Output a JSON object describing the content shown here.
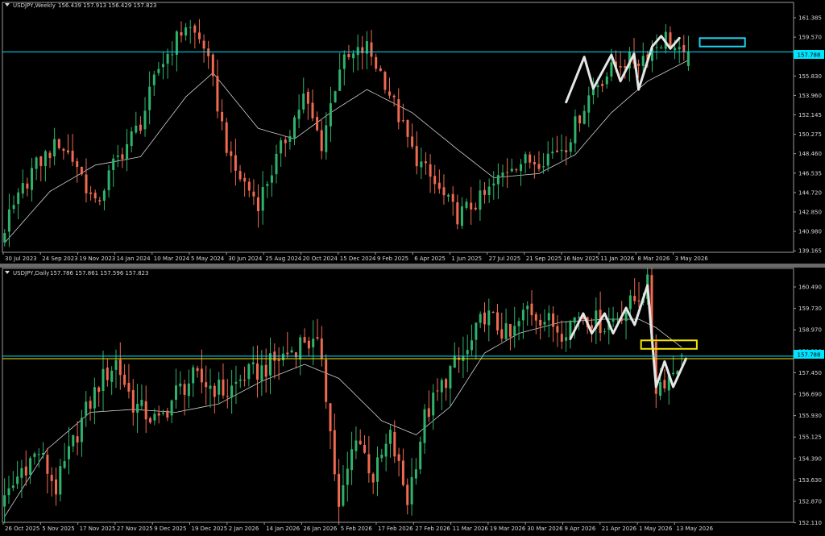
{
  "theme": {
    "background": "#000000",
    "frame": "#9a9a9a",
    "text": "#d8d8d8",
    "bull": "#2fb36c",
    "bear": "#ee6a50",
    "ma": "#d0d0d0",
    "zigzag": "#e6e6e6",
    "price_label_bg": "#00e5ff",
    "cyan_line": "#00e5ff",
    "yellow_line": "#f2e600",
    "cyan_box": "#1fd0f0",
    "yellow_box": "#f2e600"
  },
  "panes": [
    {
      "id": "weekly",
      "header": {
        "menu_icon": "triangle-down-icon",
        "symbol": "USDJPY,Weekly",
        "ohlc": "156.439 157.913 156.429 157.823"
      },
      "current_price_label": "157.788",
      "y_ticks": [
        "161.385",
        "159.570",
        "157.755",
        "155.830",
        "153.960",
        "152.145",
        "150.275",
        "148.460",
        "146.535",
        "144.720",
        "142.850",
        "140.980",
        "139.165"
      ],
      "x_labels": [
        "30 Jul 2023",
        "24 Sep 2023",
        "19 Nov 2023",
        "14 Jan 2024",
        "10 Mar 2024",
        "5 May 2024",
        "30 Jun 2024",
        "25 Aug 2024",
        "20 Oct 2024",
        "15 Dec 2024",
        "9 Feb 2025",
        "6 Apr 2025",
        "1 Jun 2025",
        "27 Jul 2025",
        "21 Sep 2025",
        "16 Nov 2025",
        "11 Jan 2026",
        "8 Mar 2026",
        "3 May 2026"
      ]
    },
    {
      "id": "daily",
      "header": {
        "menu_icon": "triangle-down-icon",
        "symbol": "USDJPY,Daily",
        "ohlc": "157.786 157.861 157.596 157.823"
      },
      "current_price_label": "157.788",
      "y_ticks": [
        "160.490",
        "159.730",
        "158.970",
        "158.210",
        "157.450",
        "156.690",
        "155.930",
        "155.125",
        "154.390",
        "153.630",
        "152.870",
        "152.110"
      ],
      "x_labels": [
        "26 Oct 2025",
        "5 Nov 2025",
        "17 Nov 2025",
        "27 Nov 2025",
        "9 Dec 2025",
        "19 Dec 2025",
        "2 Jan 2026",
        "14 Jan 2026",
        "26 Jan 2026",
        "5 Feb 2026",
        "17 Feb 2026",
        "27 Feb 2026",
        "11 Mar 2026",
        "19 Mar 2026",
        "30 Mar 2026",
        "9 Apr 2026",
        "21 Apr 2026",
        "1 May 2026",
        "13 May 2026"
      ]
    }
  ],
  "chart_data": [
    {
      "type": "candlestick",
      "symbol": "USDJPY",
      "timeframe": "Weekly",
      "last_ohlc": {
        "open": 156.439,
        "high": 157.913,
        "low": 156.429,
        "close": 157.823
      },
      "current_price": 157.788,
      "ylim": [
        138.7,
        162.5
      ],
      "x_range": [
        "30 Jul 2023",
        "May 2026"
      ],
      "close_anchors": [
        [
          0,
          141.0
        ],
        [
          6,
          146.5
        ],
        [
          12,
          149.2
        ],
        [
          16,
          147.0
        ],
        [
          20,
          143.0
        ],
        [
          24,
          147.0
        ],
        [
          30,
          151.0
        ],
        [
          34,
          156.2
        ],
        [
          40,
          160.4
        ],
        [
          44,
          158.5
        ],
        [
          50,
          147.0
        ],
        [
          56,
          143.5
        ],
        [
          62,
          149.5
        ],
        [
          66,
          153.5
        ],
        [
          70,
          149.0
        ],
        [
          74,
          156.5
        ],
        [
          80,
          158.2
        ],
        [
          84,
          155.0
        ],
        [
          90,
          148.3
        ],
        [
          96,
          144.5
        ],
        [
          100,
          142.2
        ],
        [
          106,
          144.0
        ],
        [
          112,
          147.2
        ],
        [
          118,
          147.5
        ],
        [
          124,
          149.0
        ],
        [
          130,
          154.5
        ],
        [
          136,
          156.8
        ],
        [
          140,
          157.0
        ],
        [
          146,
          159.2
        ],
        [
          150,
          157.0
        ],
        [
          151,
          157.8
        ]
      ],
      "moving_average_anchors": [
        [
          0,
          139.6
        ],
        [
          10,
          144.5
        ],
        [
          20,
          147.0
        ],
        [
          30,
          147.8
        ],
        [
          40,
          153.5
        ],
        [
          46,
          155.8
        ],
        [
          56,
          150.5
        ],
        [
          64,
          149.5
        ],
        [
          72,
          152.0
        ],
        [
          80,
          154.2
        ],
        [
          90,
          152.0
        ],
        [
          100,
          148.5
        ],
        [
          108,
          145.8
        ],
        [
          118,
          146.2
        ],
        [
          126,
          148.0
        ],
        [
          134,
          152.0
        ],
        [
          142,
          155.0
        ],
        [
          151,
          157.0
        ]
      ],
      "zigzag": [
        [
          124,
          153.0
        ],
        [
          128,
          157.3
        ],
        [
          130,
          154.3
        ],
        [
          134,
          157.5
        ],
        [
          136,
          155.0
        ],
        [
          139,
          157.6
        ],
        [
          140,
          154.2
        ],
        [
          143,
          158.3
        ],
        [
          145,
          159.3
        ],
        [
          147,
          158.1
        ],
        [
          149,
          159.1
        ]
      ],
      "horizontal_level": 157.788,
      "target_box": {
        "x_from": 153.5,
        "x_to": 163.5,
        "y_from": 158.3,
        "y_to": 159.1
      }
    },
    {
      "type": "candlestick",
      "symbol": "USDJPY",
      "timeframe": "Daily",
      "last_ohlc": {
        "open": 157.786,
        "high": 157.861,
        "low": 157.596,
        "close": 157.823
      },
      "current_price": 157.788,
      "ylim": [
        151.9,
        160.9
      ],
      "x_range": [
        "26 Oct 2025",
        "May 2026"
      ],
      "close_anchors": [
        [
          0,
          152.6
        ],
        [
          4,
          153.8
        ],
        [
          8,
          154.4
        ],
        [
          12,
          153.1
        ],
        [
          18,
          155.5
        ],
        [
          22,
          156.8
        ],
        [
          26,
          157.6
        ],
        [
          30,
          156.1
        ],
        [
          36,
          155.4
        ],
        [
          40,
          156.5
        ],
        [
          44,
          157.0
        ],
        [
          52,
          156.5
        ],
        [
          56,
          157.1
        ],
        [
          60,
          157.3
        ],
        [
          66,
          157.9
        ],
        [
          70,
          158.4
        ],
        [
          74,
          157.9
        ],
        [
          78,
          152.3
        ],
        [
          82,
          155.1
        ],
        [
          86,
          153.5
        ],
        [
          90,
          154.9
        ],
        [
          94,
          152.7
        ],
        [
          98,
          155.6
        ],
        [
          104,
          157.3
        ],
        [
          108,
          157.9
        ],
        [
          112,
          159.3
        ],
        [
          118,
          158.4
        ],
        [
          122,
          159.5
        ],
        [
          126,
          159.1
        ],
        [
          130,
          158.7
        ],
        [
          134,
          159.3
        ],
        [
          140,
          158.9
        ],
        [
          146,
          159.6
        ],
        [
          150,
          160.3
        ],
        [
          152,
          156.7
        ],
        [
          156,
          157.3
        ],
        [
          158,
          157.8
        ]
      ],
      "moving_average_anchors": [
        [
          0,
          152.1
        ],
        [
          10,
          154.5
        ],
        [
          20,
          155.8
        ],
        [
          30,
          155.9
        ],
        [
          40,
          155.8
        ],
        [
          50,
          156.1
        ],
        [
          60,
          156.9
        ],
        [
          70,
          157.5
        ],
        [
          78,
          157.0
        ],
        [
          88,
          155.5
        ],
        [
          96,
          155.0
        ],
        [
          104,
          156.0
        ],
        [
          112,
          157.9
        ],
        [
          120,
          158.6
        ],
        [
          130,
          159.0
        ],
        [
          140,
          159.1
        ],
        [
          148,
          159.1
        ],
        [
          152,
          158.8
        ],
        [
          158,
          158.1
        ]
      ],
      "zigzag": [
        [
          132,
          158.4
        ],
        [
          135,
          159.3
        ],
        [
          137,
          158.6
        ],
        [
          140,
          159.3
        ],
        [
          142,
          158.6
        ],
        [
          145,
          159.5
        ],
        [
          147,
          158.9
        ],
        [
          150,
          160.3
        ],
        [
          152,
          156.7
        ],
        [
          154,
          157.6
        ],
        [
          156,
          156.7
        ],
        [
          159,
          157.7
        ]
      ],
      "horizontal_levels": [
        157.788,
        157.7
      ],
      "target_box": {
        "x_from": 148.5,
        "x_to": 161.5,
        "y_from": 158.05,
        "y_to": 158.35
      }
    }
  ]
}
